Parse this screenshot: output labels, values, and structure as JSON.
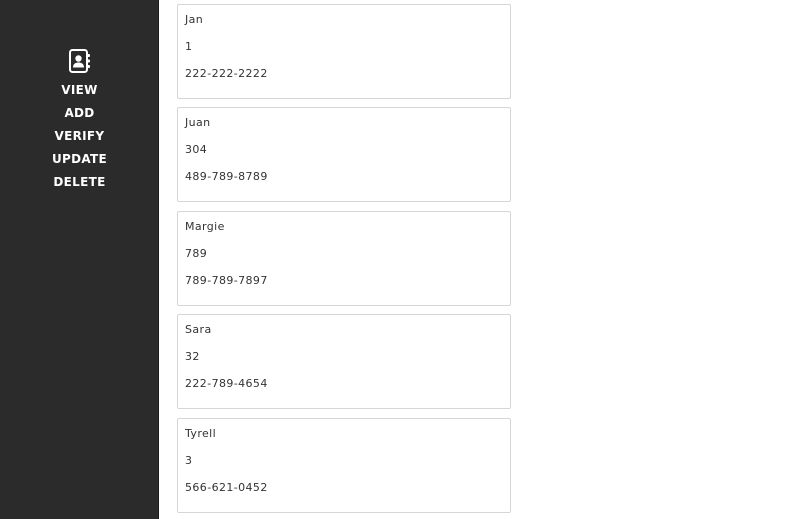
{
  "sidebar": {
    "logo_icon": "contact-book-icon",
    "nav": [
      "VIEW",
      "ADD",
      "VERIFY",
      "UPDATE",
      "DELETE"
    ]
  },
  "contacts": [
    {
      "name": "Jan",
      "id": "1",
      "phone": "222-222-2222"
    },
    {
      "name": "Juan",
      "id": "304",
      "phone": "489-789-8789"
    },
    {
      "name": "Margie",
      "id": "789",
      "phone": "789-789-7897"
    },
    {
      "name": "Sara",
      "id": "32",
      "phone": "222-789-4654"
    },
    {
      "name": "Tyrell",
      "id": "3",
      "phone": "566-621-0452"
    }
  ],
  "colors": {
    "sidebar_bg": "#2b2b2b",
    "nav_text": "#ffffff",
    "card_border": "#d6d6d6",
    "card_text": "#333333"
  }
}
